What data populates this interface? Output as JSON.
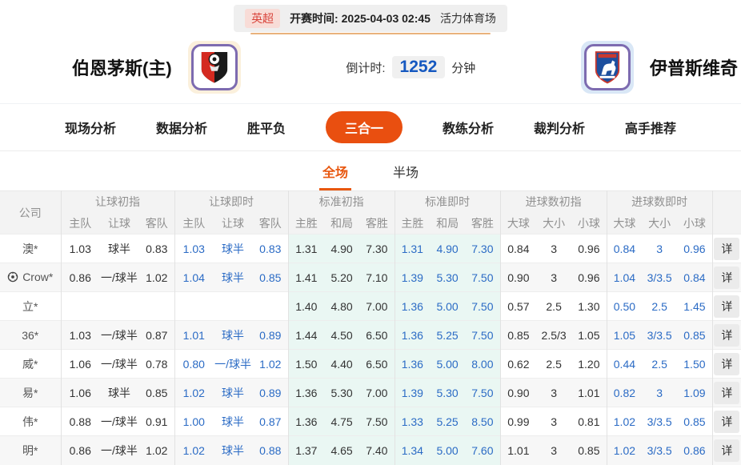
{
  "match_bar": {
    "league": "英超",
    "kickoff_label": "开赛时间:",
    "kickoff_time": "2025-04-03 02:45",
    "venue": "活力体育场"
  },
  "header": {
    "home_team": "伯恩茅斯(主)",
    "home_logo": "bournemouth-crest",
    "away_team": "伊普斯维奇",
    "away_logo": "ipswich-crest",
    "countdown_label": "倒计时:",
    "countdown_value": "1252",
    "countdown_unit": "分钟"
  },
  "nav": {
    "tabs": [
      {
        "label": "现场分析",
        "active": false
      },
      {
        "label": "数据分析",
        "active": false
      },
      {
        "label": "胜平负",
        "active": false
      },
      {
        "label": "三合一",
        "active": true
      },
      {
        "label": "教练分析",
        "active": false
      },
      {
        "label": "裁判分析",
        "active": false
      },
      {
        "label": "高手推荐",
        "active": false
      }
    ]
  },
  "sub_tabs": [
    {
      "label": "全场",
      "active": true
    },
    {
      "label": "半场",
      "active": false
    }
  ],
  "table": {
    "company_header": "公司",
    "detail_label": "详",
    "groups": [
      {
        "title": "让球初指",
        "cols": [
          "主队",
          "让球",
          "客队"
        ],
        "live": false,
        "cyan": false
      },
      {
        "title": "让球即时",
        "cols": [
          "主队",
          "让球",
          "客队"
        ],
        "live": true,
        "cyan": false
      },
      {
        "title": "标准初指",
        "cols": [
          "主胜",
          "和局",
          "客胜"
        ],
        "live": false,
        "cyan": true
      },
      {
        "title": "标准即时",
        "cols": [
          "主胜",
          "和局",
          "客胜"
        ],
        "live": true,
        "cyan": true
      },
      {
        "title": "进球数初指",
        "cols": [
          "大球",
          "大小",
          "小球"
        ],
        "live": false,
        "cyan": false
      },
      {
        "title": "进球数即时",
        "cols": [
          "大球",
          "大小",
          "小球"
        ],
        "live": true,
        "cyan": false
      }
    ],
    "rows": [
      {
        "company": "澳*",
        "icon": null,
        "cells": [
          [
            "1.03",
            "球半",
            "0.83"
          ],
          [
            "1.03",
            "球半",
            "0.83"
          ],
          [
            "1.31",
            "4.90",
            "7.30"
          ],
          [
            "1.31",
            "4.90",
            "7.30"
          ],
          [
            "0.84",
            "3",
            "0.96"
          ],
          [
            "0.84",
            "3",
            "0.96"
          ]
        ]
      },
      {
        "company": "Crow*",
        "icon": "football-icon",
        "cells": [
          [
            "0.86",
            "一/球半",
            "1.02"
          ],
          [
            "1.04",
            "球半",
            "0.85"
          ],
          [
            "1.41",
            "5.20",
            "7.10"
          ],
          [
            "1.39",
            "5.30",
            "7.50"
          ],
          [
            "0.90",
            "3",
            "0.96"
          ],
          [
            "1.04",
            "3/3.5",
            "0.84"
          ]
        ]
      },
      {
        "company": "立*",
        "icon": null,
        "cells": [
          [
            "",
            "",
            ""
          ],
          [
            "",
            "",
            ""
          ],
          [
            "1.40",
            "4.80",
            "7.00"
          ],
          [
            "1.36",
            "5.00",
            "7.50"
          ],
          [
            "0.57",
            "2.5",
            "1.30"
          ],
          [
            "0.50",
            "2.5",
            "1.45"
          ]
        ]
      },
      {
        "company": "36*",
        "icon": null,
        "cells": [
          [
            "1.03",
            "一/球半",
            "0.87"
          ],
          [
            "1.01",
            "球半",
            "0.89"
          ],
          [
            "1.44",
            "4.50",
            "6.50"
          ],
          [
            "1.36",
            "5.25",
            "7.50"
          ],
          [
            "0.85",
            "2.5/3",
            "1.05"
          ],
          [
            "1.05",
            "3/3.5",
            "0.85"
          ]
        ]
      },
      {
        "company": "威*",
        "icon": null,
        "cells": [
          [
            "1.06",
            "一/球半",
            "0.78"
          ],
          [
            "0.80",
            "一/球半",
            "1.02"
          ],
          [
            "1.50",
            "4.40",
            "6.50"
          ],
          [
            "1.36",
            "5.00",
            "8.00"
          ],
          [
            "0.62",
            "2.5",
            "1.20"
          ],
          [
            "0.44",
            "2.5",
            "1.50"
          ]
        ]
      },
      {
        "company": "易*",
        "icon": null,
        "cells": [
          [
            "1.06",
            "球半",
            "0.85"
          ],
          [
            "1.02",
            "球半",
            "0.89"
          ],
          [
            "1.36",
            "5.30",
            "7.00"
          ],
          [
            "1.39",
            "5.30",
            "7.50"
          ],
          [
            "0.90",
            "3",
            "1.01"
          ],
          [
            "0.82",
            "3",
            "1.09"
          ]
        ]
      },
      {
        "company": "伟*",
        "icon": null,
        "cells": [
          [
            "0.88",
            "一/球半",
            "0.91"
          ],
          [
            "1.00",
            "球半",
            "0.87"
          ],
          [
            "1.36",
            "4.75",
            "7.50"
          ],
          [
            "1.33",
            "5.25",
            "8.50"
          ],
          [
            "0.99",
            "3",
            "0.81"
          ],
          [
            "1.02",
            "3/3.5",
            "0.85"
          ]
        ]
      },
      {
        "company": "明*",
        "icon": null,
        "cells": [
          [
            "0.86",
            "一/球半",
            "1.02"
          ],
          [
            "1.02",
            "球半",
            "0.88"
          ],
          [
            "1.37",
            "4.65",
            "7.40"
          ],
          [
            "1.34",
            "5.00",
            "7.60"
          ],
          [
            "1.01",
            "3",
            "0.85"
          ],
          [
            "1.02",
            "3/3.5",
            "0.86"
          ]
        ]
      }
    ]
  },
  "colors": {
    "accent_orange": "#e94f10",
    "subtab_orange": "#e8570f",
    "live_odds_blue": "#2b6bc5",
    "countdown_blue": "#1558c0",
    "standard_col_cyan": "#eaf7f3",
    "league_badge_red": "#d9453c"
  }
}
